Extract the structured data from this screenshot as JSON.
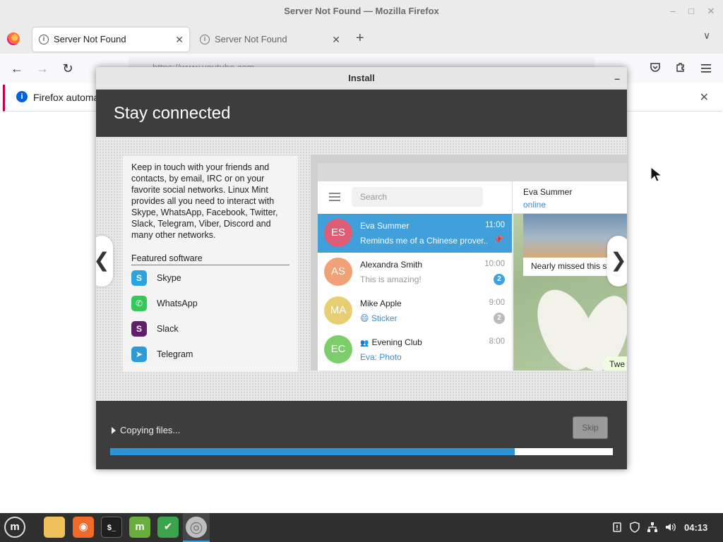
{
  "window": {
    "title": "Server Not Found — Mozilla Firefox",
    "minimize_glyph": "–",
    "maximize_glyph": "□",
    "close_glyph": "✕"
  },
  "tabs": [
    {
      "label": "Server Not Found",
      "active": true
    },
    {
      "label": "Server Not Found",
      "active": false
    }
  ],
  "tabbar": {
    "new_tab_glyph": "+",
    "list_all_glyph": "∨",
    "close_glyph": "✕"
  },
  "navbar": {
    "back_glyph": "←",
    "forward_glyph": "→",
    "reload_glyph": "↻",
    "url": "https://www.youtube.com"
  },
  "notification": {
    "icon_text": "i",
    "text": "Firefox automa",
    "close_glyph": "✕"
  },
  "installer": {
    "title": "Install",
    "minimize_glyph": "–",
    "slide_title": "Stay connected",
    "slide_text": "Keep in touch with your friends and contacts, by email, IRC or on your favorite social networks. Linux Mint provides all you need to interact with Skype, WhatsApp, Facebook, Twitter, Slack, Telegram, Viber, Discord and many other networks.",
    "featured_title": "Featured software",
    "featured": [
      {
        "name": "Skype",
        "icon": "skype-icon",
        "glyph": "S",
        "color": "#2aa3e0"
      },
      {
        "name": "WhatsApp",
        "icon": "whatsapp-icon",
        "glyph": "✆",
        "color": "#34c759"
      },
      {
        "name": "Slack",
        "icon": "slack-icon",
        "glyph": "S",
        "color": "#611f69"
      },
      {
        "name": "Telegram",
        "icon": "telegram-icon",
        "glyph": "➤",
        "color": "#2f9bd6"
      }
    ],
    "prev_glyph": "❮",
    "next_glyph": "❯",
    "status": "Copying files...",
    "skip_label": "Skip",
    "progress": 0.805
  },
  "telegram": {
    "search_placeholder": "Search",
    "chats": [
      {
        "initials": "ES",
        "name": "Eva Summer",
        "time": "11:00",
        "message": "Reminds me of a Chinese prover...",
        "color": "#e05c74",
        "selected": true,
        "pinned": true,
        "pin_glyph": "📌"
      },
      {
        "initials": "AS",
        "name": "Alexandra Smith",
        "time": "10:00",
        "message": "This is amazing!",
        "color": "#f0a176",
        "badge": "2",
        "badge_color": "#3fa2dd"
      },
      {
        "initials": "MA",
        "name": "Mike Apple",
        "time": "9:00",
        "message": "😄 Sticker",
        "color": "#e8ce73",
        "badge": "2",
        "badge_color": "#bbbbbb",
        "message_blue": true
      },
      {
        "initials": "EC",
        "name": "Evening Club",
        "group_glyph": "👥",
        "time": "8:00",
        "message": "Eva: Photo",
        "color": "#7cce6a",
        "message_blue": true
      }
    ],
    "active_chat": {
      "name": "Eva Summer",
      "status": "online",
      "image_caption": "Nearly missed this s",
      "bubble": "Twe"
    }
  },
  "taskbar": {
    "items": [
      {
        "name": "mint-menu-icon",
        "glyph": "m",
        "color": "transparent"
      },
      {
        "name": "files-icon",
        "glyph": "",
        "color": "#f1c15a"
      },
      {
        "name": "firefox-icon",
        "glyph": "◉",
        "color": "#f06a29"
      },
      {
        "name": "terminal-icon",
        "glyph": "$_",
        "color": "#1e1e1e"
      },
      {
        "name": "mintinstall-icon",
        "glyph": "m",
        "color": "#6aaf3d"
      },
      {
        "name": "shield-icon",
        "glyph": "✔",
        "color": "#3aa44d"
      },
      {
        "name": "installer-disc-icon",
        "glyph": "◎",
        "color": "#bfbfbf"
      }
    ],
    "clock": "04:13"
  },
  "colors": {
    "accent": "#2f94d6",
    "dialog_dark": "#3d3d3d",
    "notification_border": "#c50042"
  }
}
